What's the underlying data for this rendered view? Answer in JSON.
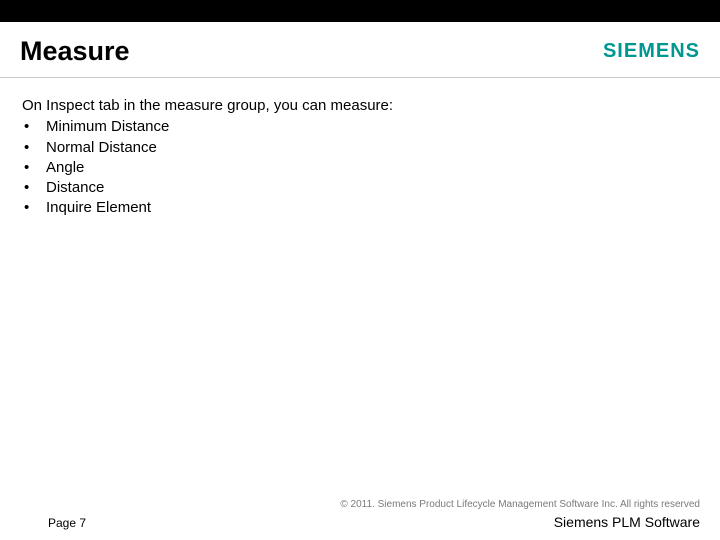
{
  "header": {
    "title": "Measure",
    "brand": "SIEMENS"
  },
  "content": {
    "intro": "On Inspect tab in the measure group, you can measure:",
    "bullets": [
      "Minimum Distance",
      "Normal Distance",
      "Angle",
      "Distance",
      "Inquire Element"
    ]
  },
  "footer": {
    "copyright": "© 2011. Siemens Product Lifecycle Management Software Inc. All rights reserved",
    "page": "Page 7",
    "plm": "Siemens PLM Software"
  }
}
